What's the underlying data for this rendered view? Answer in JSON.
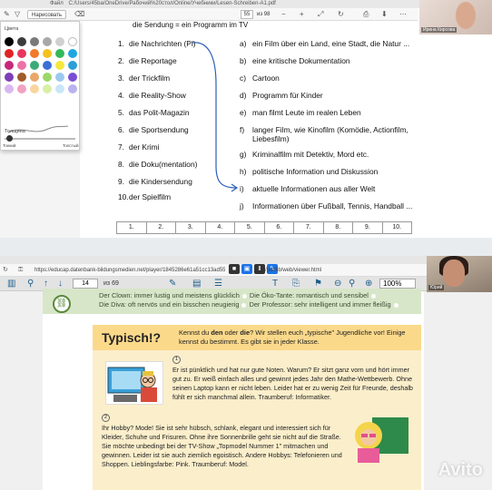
{
  "top_window": {
    "tab_label": "Файл",
    "path": "C:/Users/45ba/OneDrive/Рабочий%20стол/Online/Учебники/Lesen-Schreiben-A1.pdf",
    "draw_button": "Нарисовать",
    "page_current": "55",
    "page_total": "из 98",
    "camera_name": "Ирина Кирсова"
  },
  "palette": {
    "colors_label": "Цвета",
    "thickness_label": "Толщина",
    "thin_label": "Тонкий",
    "thick_label": "Толстый",
    "swatches": [
      "#000000",
      "#3b3b3b",
      "#7a7a7a",
      "#a8a8a8",
      "#d0d0d0",
      "#ffffff",
      "#e02424",
      "#e8365d",
      "#f07a2a",
      "#f3c21e",
      "#35b85a",
      "#1ea7e1",
      "#c8287a",
      "#ef6fa7",
      "#3caa78",
      "#3a6fd8",
      "#f5e83b",
      "#2c9ed8",
      "#7e3fb8",
      "#a15a2a",
      "#e9a76a",
      "#9bd86a",
      "#9bc9f0",
      "#7b4dd6",
      "#d9b8f0",
      "#f2a1c2",
      "#f8d6a0",
      "#d8efa6",
      "#c8e7f8",
      "#b8b2f0"
    ]
  },
  "top_doc": {
    "heading": "die Sendung = ein Programm im TV",
    "left_items": [
      {
        "n": "1.",
        "t": "die Nachrichten (Pl)"
      },
      {
        "n": "2.",
        "t": "die Reportage"
      },
      {
        "n": "3.",
        "t": "der Trickfilm"
      },
      {
        "n": "4.",
        "t": "die Reality-Show"
      },
      {
        "n": "5.",
        "t": "das Polit-Magazin"
      },
      {
        "n": "6.",
        "t": "die Sportsendung"
      },
      {
        "n": "7.",
        "t": "der Krimi"
      },
      {
        "n": "8.",
        "t": "die Doku(mentation)"
      },
      {
        "n": "9.",
        "t": "die Kindersendung"
      },
      {
        "n": "10.",
        "t": "der Spielfilm"
      }
    ],
    "right_items": [
      {
        "n": "a)",
        "t": "ein Film über ein Land, eine Stadt, die Natur ..."
      },
      {
        "n": "b)",
        "t": "eine kritische Dokumentation"
      },
      {
        "n": "c)",
        "t": "Cartoon"
      },
      {
        "n": "d)",
        "t": "Programm für Kinder"
      },
      {
        "n": "e)",
        "t": "man filmt Leute im realen Leben"
      },
      {
        "n": "f)",
        "t": "langer Film, wie Kinofilm (Komödie, Actionfilm, Liebesfilm)"
      },
      {
        "n": "g)",
        "t": "Kriminalfilm mit Detektiv, Mord etc."
      },
      {
        "n": "h)",
        "t": "politische Information und Diskussion"
      },
      {
        "n": "i)",
        "t": "aktuelle Informationen aus aller Welt"
      },
      {
        "n": "j)",
        "t": "Informationen über Fußball, Tennis, Handball ..."
      }
    ],
    "answer_cells": [
      "1.",
      "2.",
      "3.",
      "4.",
      "5.",
      "6.",
      "7.",
      "8.",
      "9.",
      "10."
    ]
  },
  "bottom_window": {
    "url": "https://educap.datenbank-bildungsmedien.net/player/1845286e61a51cc13ad55147e8845a0",
    "url_tail": "/pdf/lib/web/viewer.html",
    "page_current": "14",
    "page_total": "из 69",
    "zoom": "100%",
    "camera_name": "Юрий"
  },
  "bottom_doc": {
    "green_row1_a": "Der Clown: immer lustig und meistens glücklich",
    "green_row1_b": "Die Öko-Tante: romantisch und sensibel",
    "green_row2_a": "Die Diva: oft nervös und ein bisschen neugierig",
    "green_row2_b": "Der Professor: sehr intelligent und immer fleißig",
    "title": "Typisch!?",
    "intro_1": "Kennst du ",
    "intro_den": "den",
    "intro_2": " oder ",
    "intro_die": "die",
    "intro_3": "? Wir stellen euch „typische\" Jugendliche vor! Einige kennst du bestimmt. Es gibt sie in jeder Klasse.",
    "num1": "1",
    "para1": "Er ist pünktlich und hat nur gute Noten. Warum? Er sitzt ganz vorn und hört immer gut zu. Er weiß einfach alles und gewinnt jedes Jahr den Mathe-Wettbewerb. Ohne seinen Laptop kann er nicht leben. Leider hat er zu wenig Zeit für Freunde, deshalb fühlt er sich manchmal allein. Traumberuf: Informatiker.",
    "num2": "2",
    "para2": "Ihr Hobby? Mode! Sie ist sehr hübsch, schlank, elegant und interessiert sich für Kleider, Schuhe und Frisuren. Ohne ihre Sonnenbrille geht sie nicht auf die Straße. Sie möchte unbedingt bei der TV-Show „Topmodel Nummer 1\" mitmachen und gewinnen. Leider ist sie auch ziemlich egoistisch. Andere Hobbys: Telefonieren und Shoppen. Lieblingsfarbe: Pink. Traumberuf: Model."
  },
  "watermark": "Avito"
}
